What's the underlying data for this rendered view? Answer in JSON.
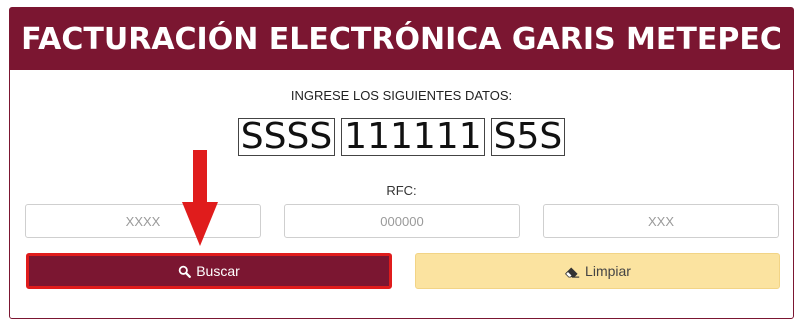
{
  "header": {
    "title": "FACTURACIÓN ELECTRÓNICA GARIS METEPEC"
  },
  "form": {
    "instruction": "INGRESE LOS SIGUIENTES DATOS:",
    "example_code": [
      "SSSS",
      "111111",
      "S5S"
    ],
    "rfc_label": "RFC:",
    "fields": [
      {
        "placeholder": "XXXX",
        "value": ""
      },
      {
        "placeholder": "000000",
        "value": ""
      },
      {
        "placeholder": "XXX",
        "value": ""
      }
    ]
  },
  "actions": {
    "search_label": "Buscar",
    "search_icon": "search-icon",
    "clear_label": "Limpiar",
    "clear_icon": "eraser-icon"
  },
  "colors": {
    "brand": "#7b1631",
    "highlight": "#e01c1c",
    "clear_button": "#fbe3a0"
  }
}
